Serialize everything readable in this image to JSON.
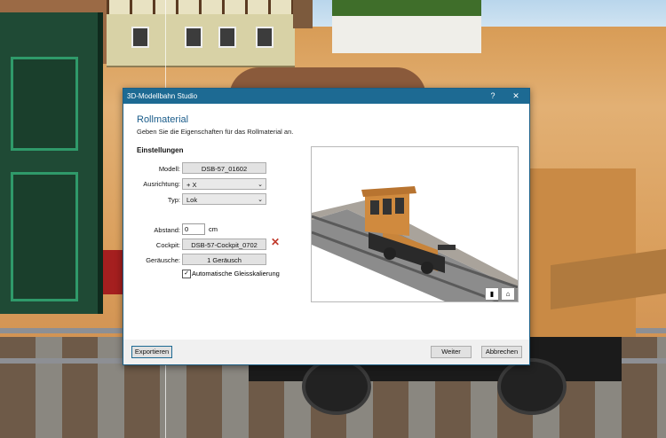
{
  "dialog": {
    "title": "3D-Modellbahn Studio",
    "help_label": "?",
    "close_label": "✕",
    "heading": "Rollmaterial",
    "subtitle": "Geben Sie die Eigenschaften für das Rollmaterial an.",
    "section_title": "Einstellungen"
  },
  "form": {
    "modell": {
      "label": "Modell:",
      "value": "DSB-57_01602"
    },
    "ausrichtung": {
      "label": "Ausrichtung:",
      "value": "+ X"
    },
    "typ": {
      "label": "Typ:",
      "value": "Lok"
    },
    "abstand": {
      "label": "Abstand:",
      "value": "0",
      "unit": "cm"
    },
    "cockpit": {
      "label": "Cockpit:",
      "value": "DSB-57-Cockpit_0702",
      "remove_icon": "✕"
    },
    "geraeusche": {
      "label": "Geräusche:",
      "value": "1 Geräusch"
    },
    "auto_scale": {
      "label": "Automatische Gleisskalierung",
      "checked": true,
      "mark": "✓"
    }
  },
  "buttons": {
    "export": "Exportieren",
    "next": "Weiter",
    "cancel": "Abbrechen"
  },
  "colors": {
    "titlebar": "#1d6a93",
    "heading": "#1a5c8a",
    "remove": "#c0392b"
  }
}
